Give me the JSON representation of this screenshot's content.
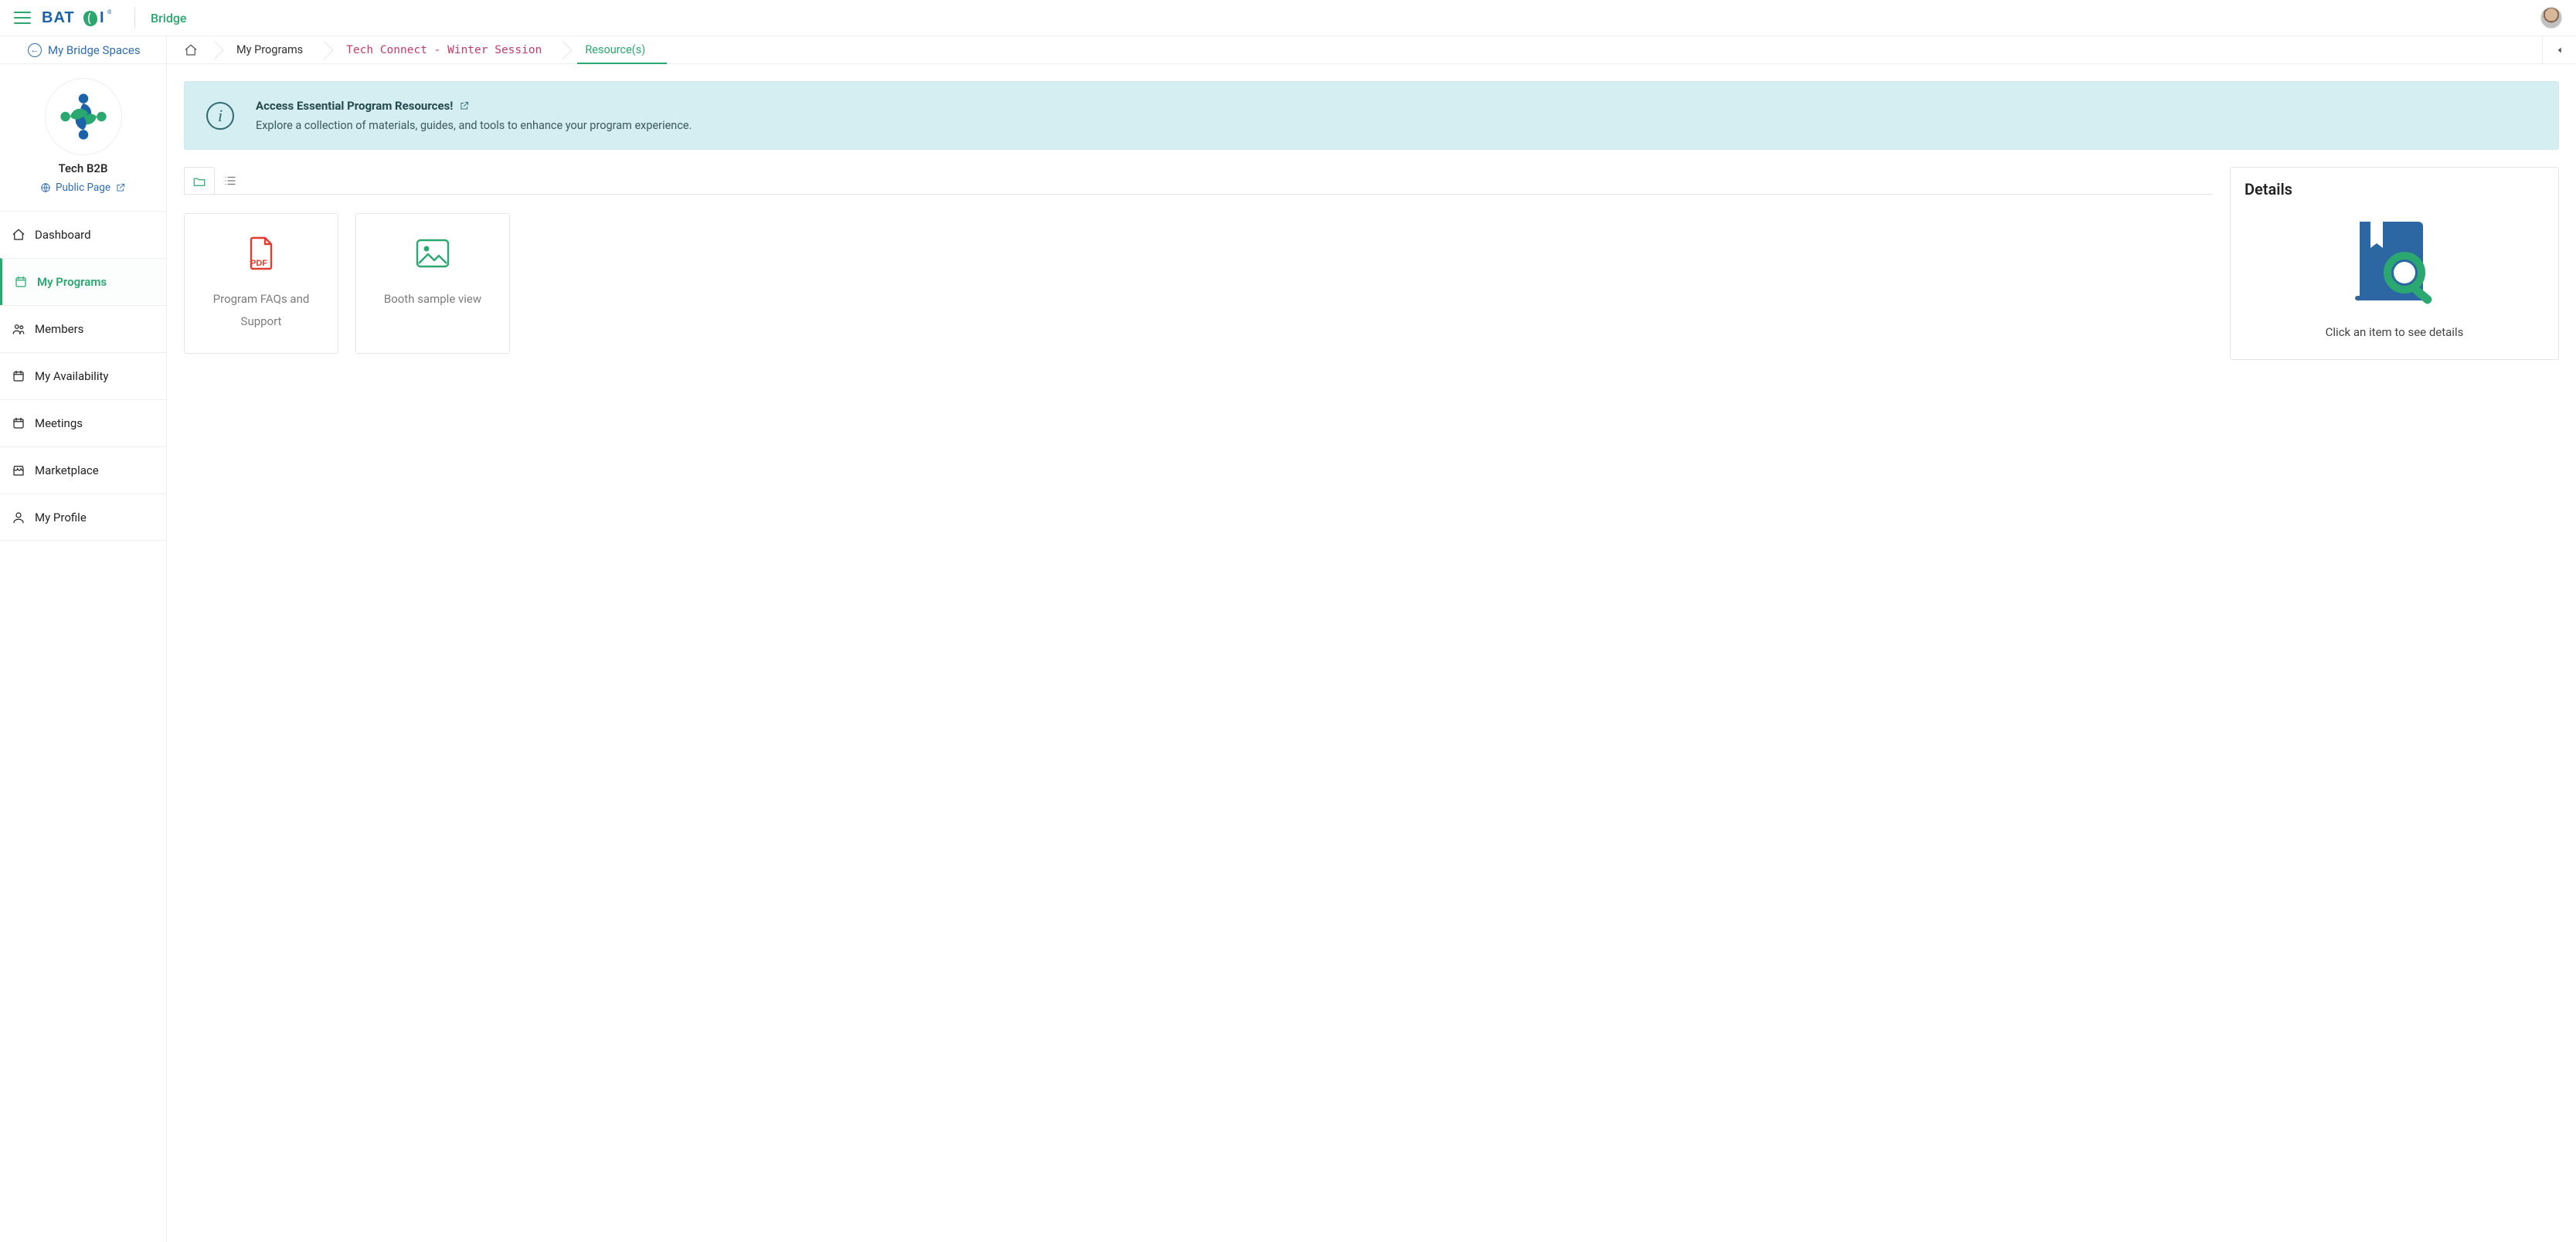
{
  "header": {
    "product": "Bridge"
  },
  "back_link": "My Bridge Spaces",
  "breadcrumb": {
    "items": [
      "My Programs",
      "Tech Connect - Winter Session",
      "Resource(s)"
    ]
  },
  "org": {
    "name": "Tech B2B",
    "public_link": "Public Page"
  },
  "nav": {
    "items": [
      {
        "label": "Dashboard",
        "icon": "home-icon"
      },
      {
        "label": "My Programs",
        "icon": "calendar-icon",
        "active": true
      },
      {
        "label": "Members",
        "icon": "members-icon"
      },
      {
        "label": "My Availability",
        "icon": "calendar-outline-icon"
      },
      {
        "label": "Meetings",
        "icon": "calendar-outline-icon"
      },
      {
        "label": "Marketplace",
        "icon": "store-icon"
      },
      {
        "label": "My Profile",
        "icon": "user-icon"
      }
    ]
  },
  "banner": {
    "title": "Access Essential Program Resources!",
    "desc": "Explore a collection of materials, guides, and tools to enhance your program experience."
  },
  "resources": [
    {
      "title": "Program FAQs and Support",
      "icon": "pdf"
    },
    {
      "title": "Booth sample view",
      "icon": "image"
    }
  ],
  "details": {
    "heading": "Details",
    "empty_msg": "Click an item to see details"
  }
}
